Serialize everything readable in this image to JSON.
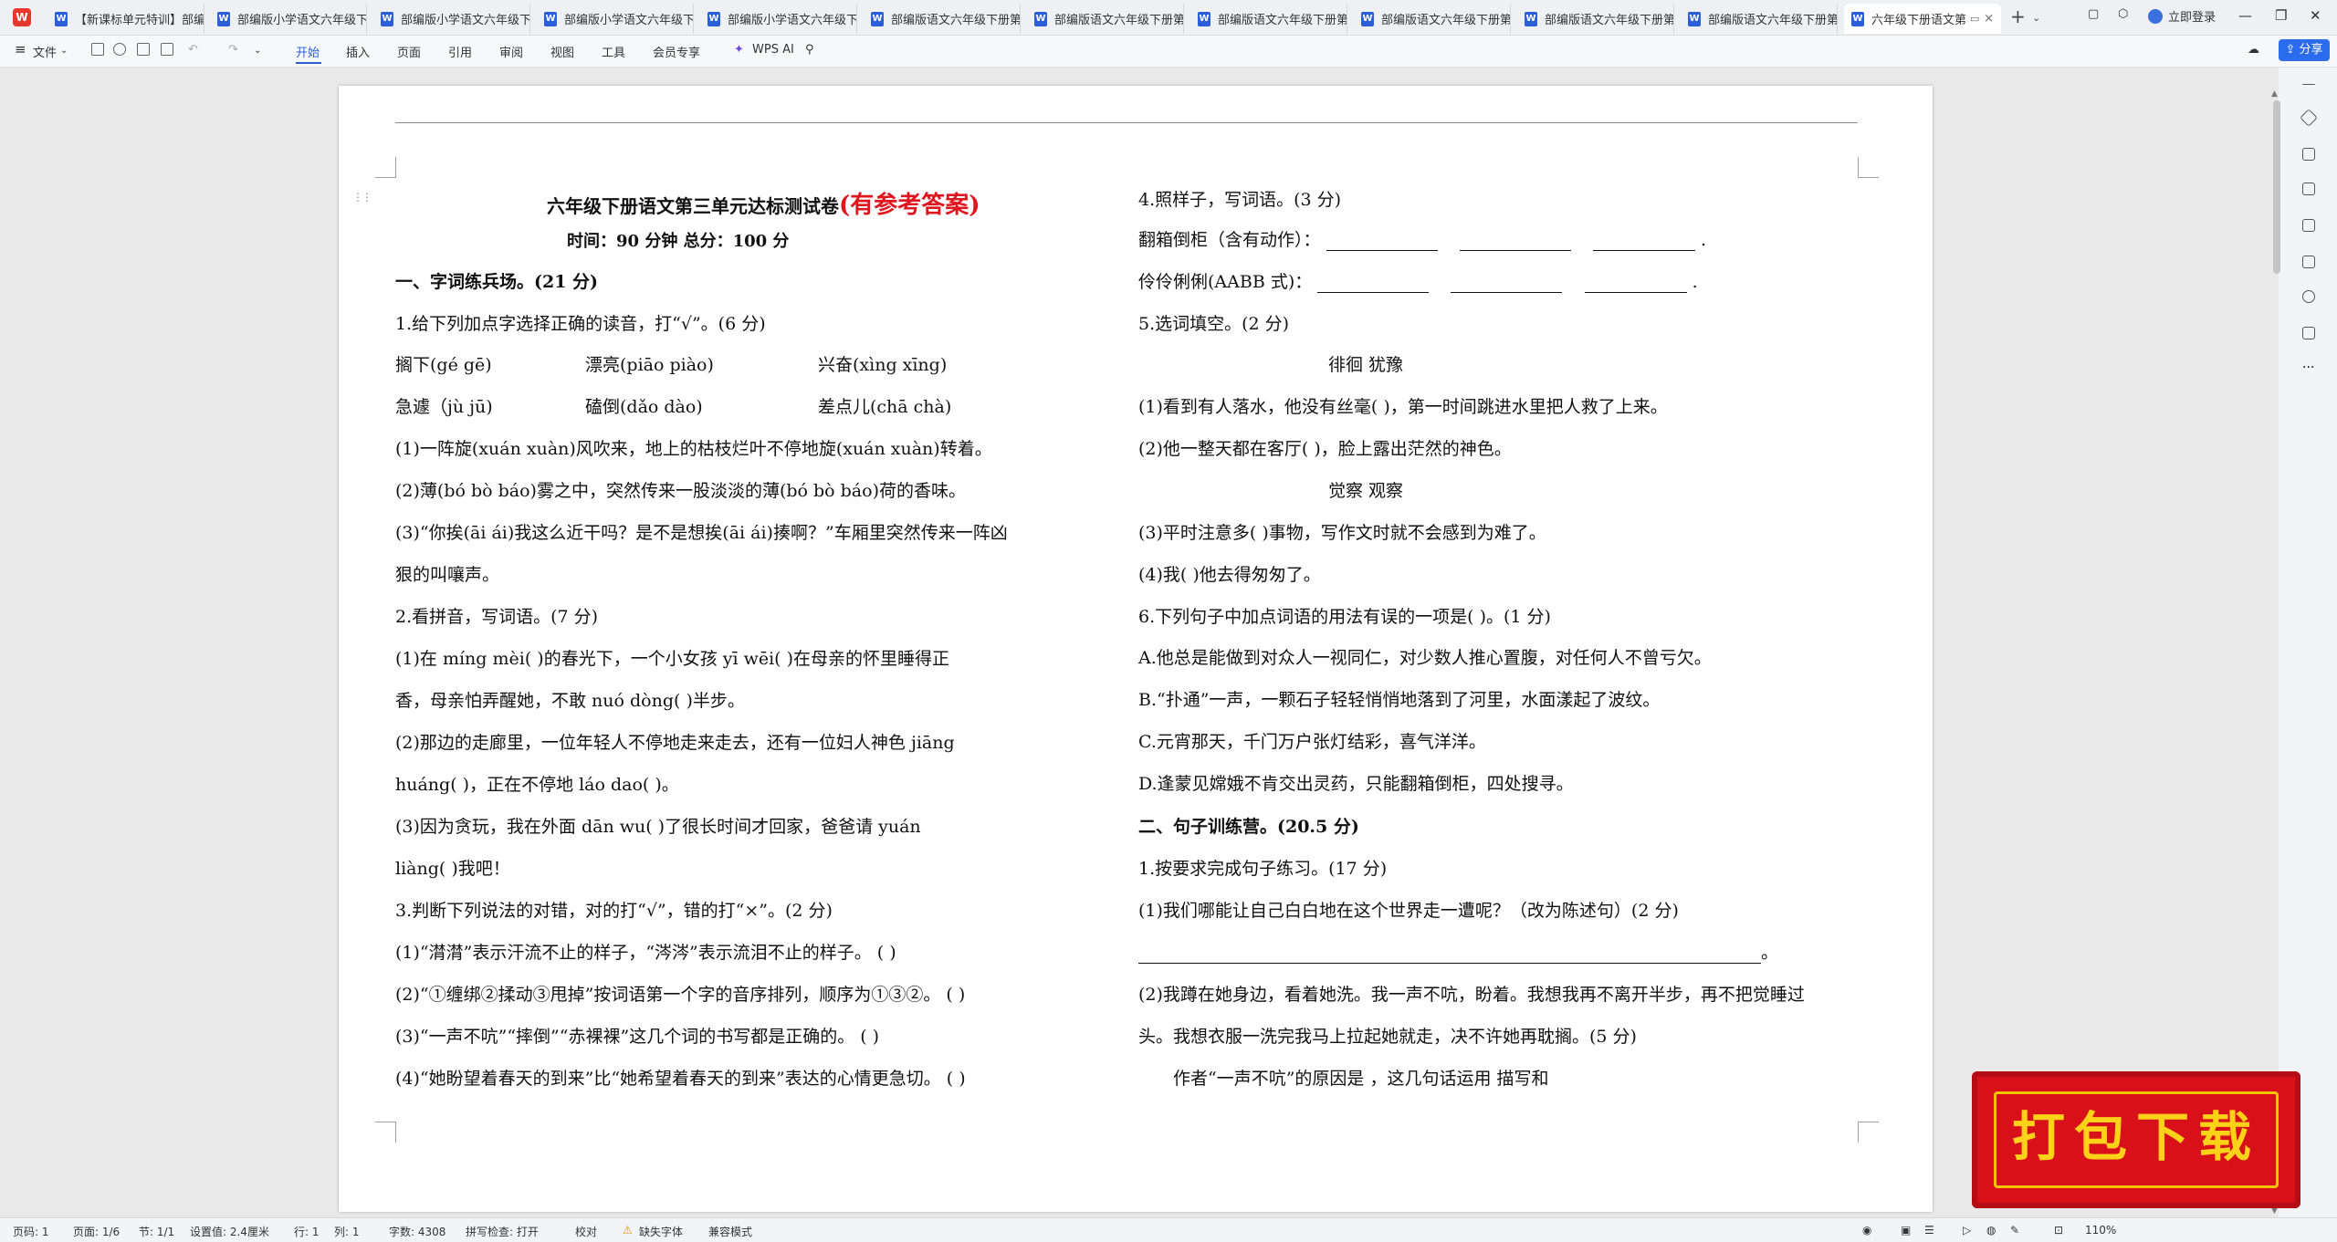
{
  "app": {
    "logo": "W"
  },
  "tabs": [
    {
      "label": "【新课标单元特训】部编",
      "active": false
    },
    {
      "label": "部编版小学语文六年级下",
      "active": false
    },
    {
      "label": "部编版小学语文六年级下",
      "active": false
    },
    {
      "label": "部编版小学语文六年级下",
      "active": false
    },
    {
      "label": "部编版小学语文六年级下",
      "active": false
    },
    {
      "label": "部编版语文六年级下册第",
      "active": false
    },
    {
      "label": "部编版语文六年级下册第",
      "active": false
    },
    {
      "label": "部编版语文六年级下册第",
      "active": false
    },
    {
      "label": "部编版语文六年级下册第",
      "active": false
    },
    {
      "label": "部编版语文六年级下册第",
      "active": false
    },
    {
      "label": "部编版语文六年级下册第",
      "active": false
    },
    {
      "label": "六年级下册语文第",
      "active": true
    }
  ],
  "tab_new": "+",
  "tab_close": "×",
  "login": "立即登录",
  "window": {
    "minimize": "—",
    "restore": "❐",
    "close": "✕"
  },
  "toolbar": {
    "file": "文件",
    "menus": [
      "开始",
      "插入",
      "页面",
      "引用",
      "审阅",
      "视图",
      "工具",
      "会员专享"
    ],
    "active_menu": "开始",
    "ai": "WPS AI",
    "share": "分享"
  },
  "doc": {
    "title": "六年级下册语文第三单元达标测试卷",
    "title_red": "(有参考答案)",
    "subtitle": "时间：90 分钟   总分：100 分",
    "left": {
      "sec1": "一、字词练兵场。(21 分)",
      "q1": "1.给下列加点字选择正确的读音，打“√”。(6 分)",
      "q1_r1": [
        "搁下(gé  gē)",
        "漂亮(piāo  piào)",
        "兴奋(xìng  xīng)"
      ],
      "q1_r2": [
        "急遽（jù  jū)",
        "磕倒(dǎo dào)",
        "差点儿(chā chà)"
      ],
      "q1_s1": "(1)一阵旋(xuán  xuàn)风吹来，地上的枯枝烂叶不停地旋(xuán xuàn)转着。",
      "q1_s2": "(2)薄(bó bò báo)雾之中，突然传来一股淡淡的薄(bó bò báo)荷的香味。",
      "q1_s3a": "(3)“你挨(āi  ái)我这么近干吗？是不是想挨(āi  ái)揍啊？”车厢里突然传来一阵凶",
      "q1_s3b": "狠的叫嚷声。",
      "q2": "2.看拼音，写词语。(7 分)",
      "q2_s1a": "(1)在 míng mèi(        )的春光下，一个小女孩 yī wēi(        )在母亲的怀里睡得正",
      "q2_s1b": "香，母亲怕弄醒她，不敢 nuó dòng(      )半步。",
      "q2_s2a": "(2)那边的走廊里，一位年轻人不停地走来走去，还有一位妇人神色 jiāng",
      "q2_s2b": "huáng(        )，正在不停地 láo dao(       )。",
      "q2_s3a": "(3)因为贪玩，我在外面 dān wu(        )了很长时间才回家，爸爸请 yuán",
      "q2_s3b": "liàng(        )我吧！",
      "q3": "3.判断下列说法的对错，对的打“√”，错的打“×”。(2 分)",
      "q3_1": "(1)“潸潸”表示汗流不止的样子，“涔涔”表示流泪不止的样子。      (      )",
      "q3_2": "(2)“①缠绑②揉动③甩掉”按词语第一个字的音序排列，顺序为①③②。  (      )",
      "q3_3": "(3)“一声不吭”“摔倒”“赤裸裸”这几个词的书写都是正确的。      (      )",
      "q3_4": "(4)“她盼望着春天的到来”比“她希望着春天的到来”表达的心情更急切。  (      )"
    },
    "right": {
      "q4": "4.照样子，写词语。(3 分)",
      "q4_1": "翻箱倒柜（含有动作）：",
      "q4_2": "伶伶俐俐(AABB 式)：",
      "q4_end": ".",
      "q5": "5.选词填空。(2 分)",
      "q5_w1": "徘徊          犹豫",
      "q5_1": "(1)看到有人落水，他没有丝毫(          )，第一时间跳进水里把人救了上来。",
      "q5_2": "(2)他一整天都在客厅(          )，脸上露出茫然的神色。",
      "q5_w2": "觉察          观察",
      "q5_3": "(3)平时注意多(          )事物，写作文时就不会感到为难了。",
      "q5_4": "(4)我(          )他去得匆匆了。",
      "q6": "6.下列句子中加点词语的用法有误的一项是(        )。(1 分)",
      "q6_a": "A.他总是能做到对众人一视同仁，对少数人推心置腹，对任何人不曾亏欠。",
      "q6_b": "B.“扑通”一声，一颗石子轻轻悄悄地落到了河里，水面漾起了波纹。",
      "q6_c": "C.元宵那天，千门万户张灯结彩，喜气洋洋。",
      "q6_d": "D.逢蒙见嫦娥不肯交出灵药，只能翻箱倒柜，四处搜寻。",
      "sec2": "二、句子训练营。(20.5 分)",
      "s1": "1.按要求完成句子练习。(17 分)",
      "s1_1": "(1)我们哪能让自己白白地在这个世界走一遭呢？（改为陈述句）(2 分)",
      "s1_1_end": "。",
      "s1_2a": "(2)我蹲在她身边，看着她洗。我一声不吭，盼着。我想我再不离开半步，再不把觉睡过",
      "s1_2b": "头。我想衣服一洗完我马上拉起她就走，决不许她再耽搁。(5 分)",
      "s1_3": "作者“一声不吭”的原因是                    ，这几句话运用          描写和"
    }
  },
  "status": {
    "page": "页码: 1",
    "pages": "页面: 1/6",
    "section": "节: 1/1",
    "setting": "设置值: 2.4厘米",
    "row": "行: 1",
    "col": "列: 1",
    "words": "字数: 4308",
    "spell": "拼写检查: 打开",
    "proof": "校对",
    "font_missing": "缺失字体",
    "compat": "兼容模式",
    "zoom": "110%"
  },
  "banner": {
    "text": "打包下载"
  },
  "colors": {
    "accent": "#2b5fd9",
    "red": "#e0161e",
    "banner_bg": "#d8101a",
    "banner_text": "#ffd21a"
  }
}
